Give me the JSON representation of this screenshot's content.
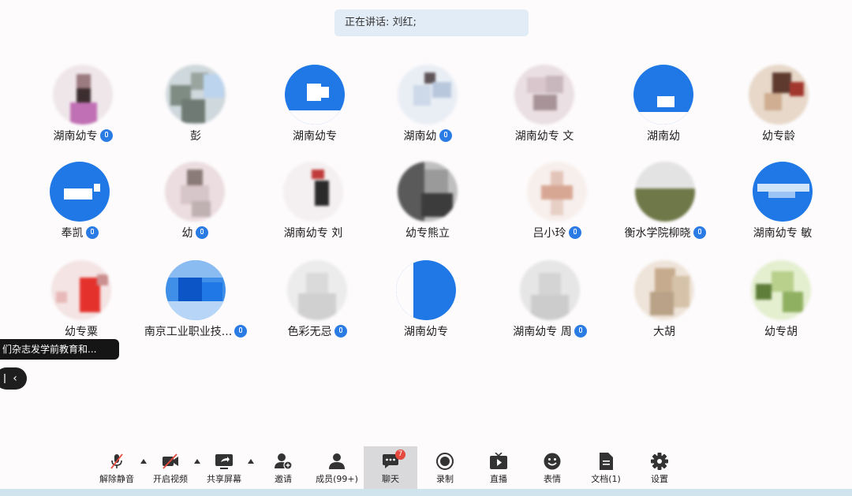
{
  "speaking": {
    "text": "正在讲话: 刘红;"
  },
  "participants": [
    {
      "name": "湖南幼专",
      "mic": true
    },
    {
      "name": "彭",
      "mic": false
    },
    {
      "name": "湖南幼专",
      "mic": false
    },
    {
      "name": "湖南幼",
      "mic": true
    },
    {
      "name": "湖南幼专 文",
      "mic": false
    },
    {
      "name": "湖南幼",
      "mic": false
    },
    {
      "name": "幼专龄",
      "mic": false
    },
    {
      "name": "奉凯",
      "mic": true
    },
    {
      "name": "幼",
      "mic": true
    },
    {
      "name": "湖南幼专 刘",
      "mic": false
    },
    {
      "name": "幼专熊立",
      "mic": false
    },
    {
      "name": "吕小玲",
      "mic": true
    },
    {
      "name": "衡水学院柳晓",
      "mic": true
    },
    {
      "name": "湖南幼专 敏",
      "mic": false
    },
    {
      "name": "幼专粟",
      "mic": false
    },
    {
      "name": "南京工业职业技...",
      "mic": true
    },
    {
      "name": "色彩无忌",
      "mic": true
    },
    {
      "name": "湖南幼专",
      "mic": false
    },
    {
      "name": "湖南幼专 周",
      "mic": true
    },
    {
      "name": "大胡",
      "mic": false
    },
    {
      "name": "幼专胡",
      "mic": false
    }
  ],
  "chat_notice": {
    "text": "们杂志发学前教育和..."
  },
  "collapse_button": {
    "icon": "chevron-left-icon"
  },
  "toolbar": {
    "unmute": "解除静音",
    "start_video": "开启视频",
    "share_screen": "共享屏幕",
    "invite": "邀请",
    "members": "成员(99+)",
    "chat": "聊天",
    "chat_badge": "7",
    "record": "录制",
    "live": "直播",
    "reactions": "表情",
    "docs": "文档(1)",
    "settings": "设置"
  },
  "colors": {
    "accent": "#2a7be4",
    "badge": "#e5483d",
    "speaking_bg": "#e2ecf6"
  }
}
